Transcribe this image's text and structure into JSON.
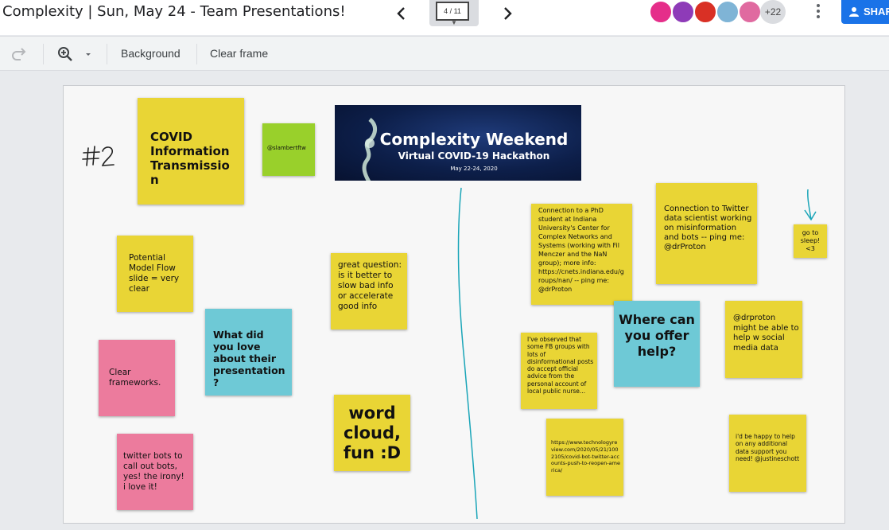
{
  "header": {
    "title": "Complexity | Sun, May 24 - Team Presentations!",
    "frame_counter": "4 / 11",
    "avatar_overflow": "+22",
    "share_label": "SHARE",
    "avatar_colors": [
      "#e52e8a",
      "#8e3bb8",
      "#d93025",
      "#7fb4d6",
      "#e06aa0"
    ]
  },
  "toolbar": {
    "background_label": "Background",
    "clear_frame_label": "Clear frame"
  },
  "board": {
    "handwriting": "#2",
    "banner": {
      "title": "Complexity Weekend",
      "subtitle": "Virtual COVID-19 Hackathon",
      "date": "May 22-24, 2020"
    },
    "notes": [
      {
        "id": "covid-info",
        "text": "COVID Information Transmission",
        "color": "#e9d535"
      },
      {
        "id": "slambert",
        "text": "@slambertftw",
        "color": "#99d02b"
      },
      {
        "id": "model-flow",
        "text": "Potential Model Flow slide = very clear",
        "color": "#e9d535"
      },
      {
        "id": "great-question",
        "text": "great question: is it better to slow bad info or accelerate good info",
        "color": "#e9d535"
      },
      {
        "id": "what-love",
        "text": "What did you love about their presentation?",
        "color": "#6ec9d6"
      },
      {
        "id": "clear-frameworks",
        "text": "Clear frameworks.",
        "color": "#ec7b9d"
      },
      {
        "id": "word-cloud",
        "text": "word cloud, fun :D",
        "color": "#e9d535"
      },
      {
        "id": "twitter-bots",
        "text": "twitter bots to call out bots, yes! the irony! i love it!",
        "color": "#ec7b9d"
      },
      {
        "id": "phd-connection",
        "text": "Connection to a PhD student at Indiana University's Center for Complex Networks and Systems (working with Fil Menczer and the NaN group); more info: https://cnets.indiana.edu/groups/nan/ -- ping me: @drProton",
        "color": "#e9d535"
      },
      {
        "id": "twitter-scientist",
        "text": "Connection to Twitter data scientist working on misinformation and bots -- ping me: @drProton",
        "color": "#e9d535"
      },
      {
        "id": "go-to-sleep",
        "text": "go to sleep! <3",
        "color": "#e9d535"
      },
      {
        "id": "where-help",
        "text": "Where can you offer help?",
        "color": "#6ec9d6"
      },
      {
        "id": "fb-groups",
        "text": "I've observed that some FB groups with lots of disinformational posts do accept official advice from the personal account of local public nurse...",
        "color": "#e9d535"
      },
      {
        "id": "drproton-help",
        "text": "@drproton might be able to help w social media data",
        "color": "#e9d535"
      },
      {
        "id": "tech-review-link",
        "text": "https://www.technologyreview.com/2020/05/21/1002105/covid-bot-twitter-accounts-push-to-reopen-america/",
        "color": "#e9d535"
      },
      {
        "id": "justineschott",
        "text": "i'd be happy to help on any additional data support you need! @justineschott",
        "color": "#e9d535"
      }
    ]
  }
}
